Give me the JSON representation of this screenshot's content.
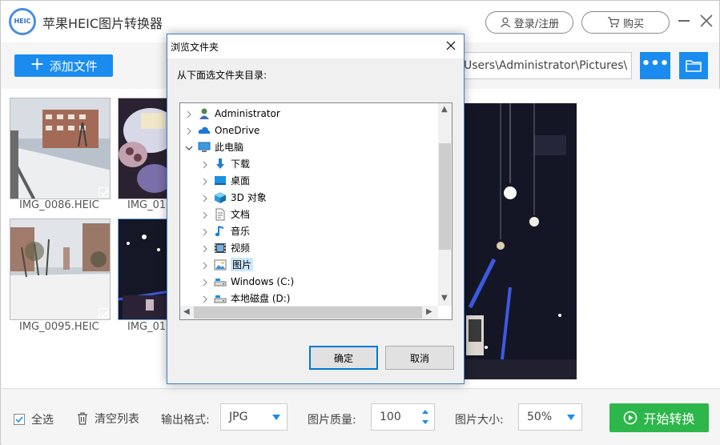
{
  "app": {
    "title": "苹果HEIC图片转换器",
    "logo_text": "HEIC",
    "login_label": "登录/注册",
    "buy_label": "购买"
  },
  "toolbar": {
    "add_file_label": "添加文件",
    "path_value": "Users\\Administrator\\Pictures\\",
    "more_label": "•••"
  },
  "thumbnails": [
    {
      "label": "IMG_0086.HEIC",
      "checked": true
    },
    {
      "label": "IMG_01",
      "checked": false
    },
    {
      "label": "IMG_0095.HEIC",
      "checked": true
    },
    {
      "label": "IMG_01",
      "checked": false
    }
  ],
  "bottom": {
    "select_all_label": "全选",
    "clear_list_label": "清空列表",
    "output_format_label": "输出格式:",
    "output_format_value": "JPG",
    "quality_label": "图片质量:",
    "quality_value": "100",
    "size_label": "图片大小:",
    "size_value": "50%",
    "start_label": "开始转换"
  },
  "dialog": {
    "title": "浏览文件夹",
    "instruction": "从下面选文件夹目录:",
    "ok_label": "确定",
    "cancel_label": "取消",
    "tree": [
      {
        "label": "Administrator",
        "icon": "user-icon",
        "level": 0,
        "expanded": false,
        "selected": false
      },
      {
        "label": "OneDrive",
        "icon": "cloud-icon",
        "level": 0,
        "expanded": false,
        "selected": false
      },
      {
        "label": "此电脑",
        "icon": "computer-icon",
        "level": 0,
        "expanded": true,
        "selected": false
      },
      {
        "label": "下载",
        "icon": "download-icon",
        "level": 1,
        "expanded": false,
        "selected": false
      },
      {
        "label": "桌面",
        "icon": "desktop-icon",
        "level": 1,
        "expanded": false,
        "selected": false
      },
      {
        "label": "3D 对象",
        "icon": "cube-icon",
        "level": 1,
        "expanded": false,
        "selected": false
      },
      {
        "label": "文档",
        "icon": "document-icon",
        "level": 1,
        "expanded": false,
        "selected": false
      },
      {
        "label": "音乐",
        "icon": "music-icon",
        "level": 1,
        "expanded": false,
        "selected": false
      },
      {
        "label": "视频",
        "icon": "video-icon",
        "level": 1,
        "expanded": false,
        "selected": false
      },
      {
        "label": "图片",
        "icon": "pictures-icon",
        "level": 1,
        "expanded": false,
        "selected": true
      },
      {
        "label": "Windows (C:)",
        "icon": "drive-icon",
        "level": 1,
        "expanded": false,
        "selected": false
      },
      {
        "label": "本地磁盘 (D:)",
        "icon": "drive-icon",
        "level": 1,
        "expanded": false,
        "selected": false
      }
    ]
  },
  "colors": {
    "accent": "#1a8cf0",
    "start_green": "#2db64a",
    "dialog_border": "#3d7fd1",
    "selection": "#cce8ff"
  }
}
